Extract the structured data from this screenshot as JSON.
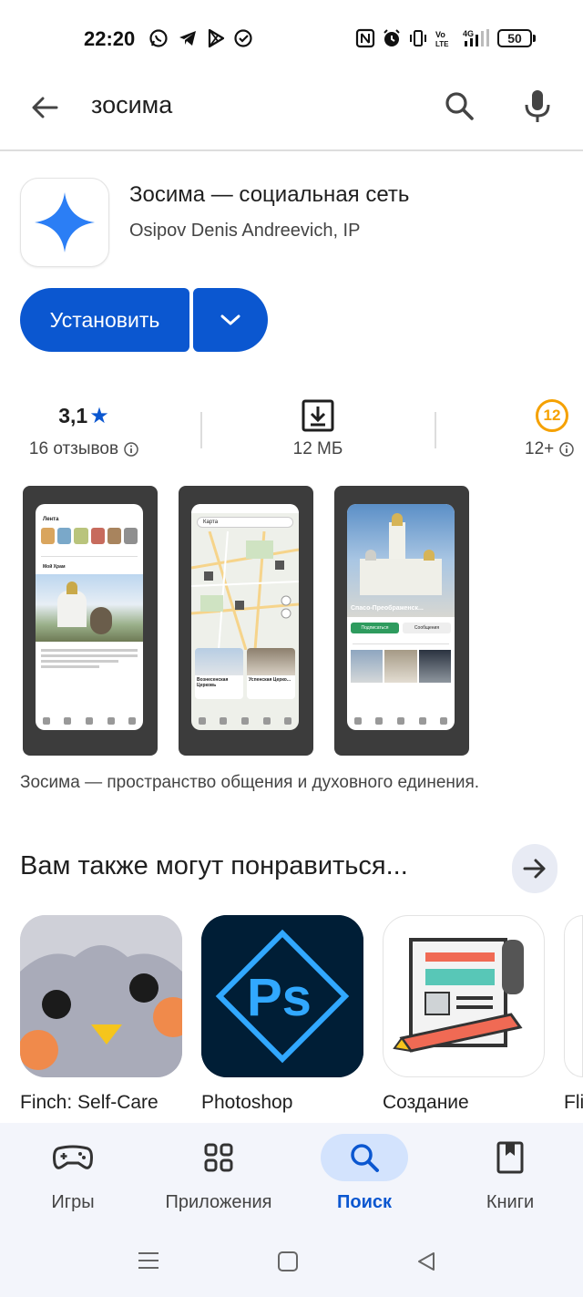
{
  "status": {
    "time": "22:20",
    "battery": "50"
  },
  "search": {
    "query": "зосима"
  },
  "app": {
    "title": "Зосима — социальная сеть",
    "developer": "Osipov Denis Andreevich, IP",
    "install_label": "Установить",
    "rating": "3,1",
    "reviews": "16 отзывов",
    "size": "12 МБ",
    "age": "12+",
    "age_badge": "12",
    "description": "Зосима — пространство общения и духовного единения."
  },
  "screenshots": [
    {
      "caption": "Лента",
      "post": "Мой Храм"
    },
    {
      "caption": "Карта",
      "place1": "Вознесенская Церковь",
      "place2": "Успенская Церко..."
    },
    {
      "caption": "Спасо-Преображенск...",
      "subscribe": "Подписаться",
      "message": "Сообщения"
    }
  ],
  "recommendations": {
    "title": "Вам также могут понравиться...",
    "items": [
      {
        "label": "Finch: Self-Care"
      },
      {
        "label": "Photoshop"
      },
      {
        "label": "Создание"
      },
      {
        "label": "Fli"
      }
    ]
  },
  "nav": {
    "items": [
      {
        "label": "Игры"
      },
      {
        "label": "Приложения"
      },
      {
        "label": "Поиск"
      },
      {
        "label": "Книги"
      }
    ]
  },
  "colors": {
    "accent": "#0b57d0",
    "star": "#0b57d0",
    "age_badge": "#f5a100"
  }
}
